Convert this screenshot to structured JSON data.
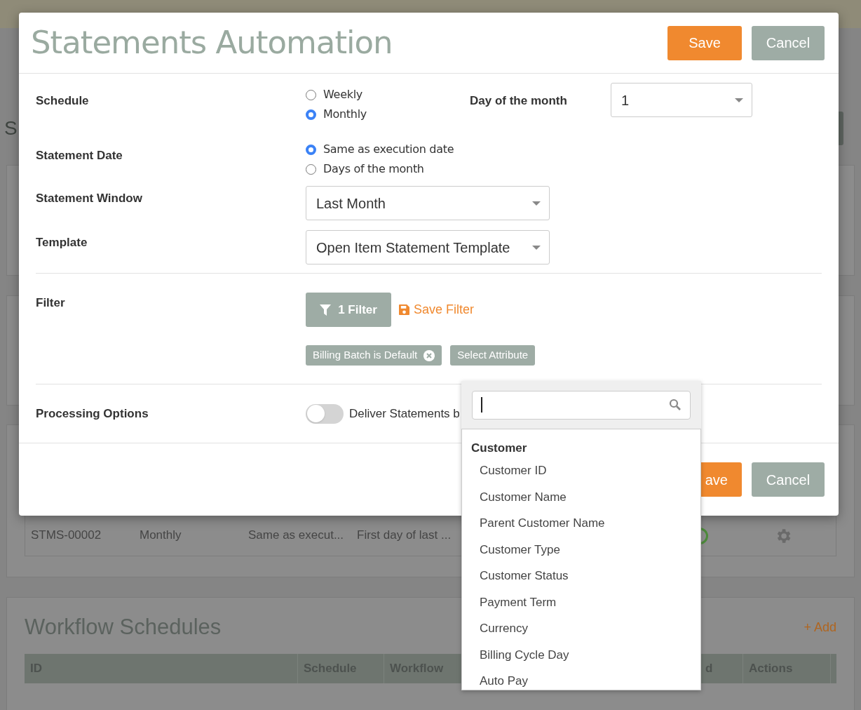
{
  "background": {
    "heading": "S",
    "statements_row": {
      "cells": [
        "STMS-00002",
        "Monthly",
        "Same as execut...",
        "First day of last ..."
      ]
    },
    "workflow": {
      "title": "Workflow Schedules",
      "add": "+ Add",
      "columns": [
        "ID",
        "Schedule",
        "Workflow",
        "d",
        "Actions"
      ]
    }
  },
  "modal": {
    "title": "Statements Automation",
    "header_buttons": [
      "Save",
      "Cancel"
    ],
    "schedule": {
      "label": "Schedule",
      "options": [
        {
          "label": "Weekly",
          "selected": false
        },
        {
          "label": "Monthly",
          "selected": true
        }
      ]
    },
    "day_of_month": {
      "label": "Day of the month",
      "value": "1"
    },
    "statement_date": {
      "label": "Statement Date",
      "options": [
        {
          "label": "Same as execution date",
          "selected": true
        },
        {
          "label": "Days of the month",
          "selected": false
        }
      ]
    },
    "statement_window": {
      "label": "Statement Window",
      "value": "Last Month"
    },
    "template": {
      "label": "Template",
      "value": "Open Item Statement Template"
    },
    "filter": {
      "label": "Filter",
      "button": "1 Filter",
      "save": "Save Filter",
      "tags": [
        "Billing Batch is Default"
      ],
      "select_attribute": "Select Attribute"
    },
    "processing": {
      "label": "Processing Options",
      "toggle": {
        "on": false,
        "label": "Deliver Statements b"
      }
    },
    "footer_buttons": [
      "ave",
      "Cancel"
    ]
  },
  "attribute_dropdown": {
    "groups": [
      {
        "name": "Customer",
        "items": [
          "Customer ID",
          "Customer Name",
          "Parent Customer Name",
          "Customer Type",
          "Customer Status",
          "Payment Term",
          "Currency",
          "Billing Cycle Day",
          "Auto Pay"
        ]
      }
    ]
  }
}
